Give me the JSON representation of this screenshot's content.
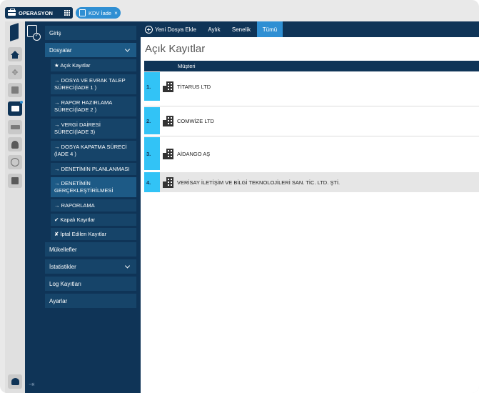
{
  "topbar": {
    "app_label": "OPERASYON",
    "doc_tab_label": "KDV İade",
    "doc_tab_close": "×"
  },
  "rail": {
    "icons": [
      "home-icon",
      "move-icon",
      "book-icon",
      "briefcase-icon",
      "money-icon",
      "user-icon",
      "globe-icon",
      "calculator-icon",
      "user-settings-icon"
    ]
  },
  "nav": {
    "giris": "Giriş",
    "dosyalar": "Dosyalar",
    "sub": {
      "acik": "★ Açık Kayıtlar",
      "dosya_evrak": "→ DOSYA VE EVRAK TALEP SÜRECİ(İADE 1 )",
      "rapor_hazirlama": "→ RAPOR HAZIRLAMA SÜRECİ(İADE 2 )",
      "vergi_dairesi": "→ VERGİ DAİRESİ SÜRECİ(İADE 3)",
      "dosya_kapatma": "→ DOSYA KAPATMA SÜRECİ (İADE 4 )",
      "denetim_plan": "→ DENETİMİN PLANLANMASI",
      "denetim_gerc": "→ DENETİMİN GERÇEKLEŞTİRİLMESİ",
      "raporlama": "→ RAPORLAMA",
      "kapali": "✔ Kapalı Kayıtlar",
      "iptal": "✘ İptal Edilen Kayıtlar"
    },
    "mukellefler": "Mükellefler",
    "istatistikler": "İstatistikler",
    "log": "Log Kayıtları",
    "ayarlar": "Ayarlar"
  },
  "toolbar": {
    "new_label": "Yeni Dosya Ekle",
    "tab_aylik": "Aylık",
    "tab_senelik": "Senelik",
    "tab_tumu": "Tümü",
    "active_tab": "Tümü"
  },
  "main": {
    "title": "Açık Kayıtlar",
    "column_header": "Müşteri",
    "rows": [
      {
        "num": "1.",
        "name": "TİTARUS LTD"
      },
      {
        "num": "2.",
        "name": "COMWİZE LTD"
      },
      {
        "num": "3.",
        "name": "AİDANGO AŞ"
      },
      {
        "num": "4.",
        "name": "VERİSAY İLETİŞİM VE BİLGİ TEKNOLOJİLERİ SAN. TİC. LTD. ŞTİ."
      }
    ]
  },
  "colors": {
    "navy": "#0f3457",
    "nav_item": "#164469",
    "accent_blue": "#2f8fd3",
    "row_number": "#32c3f6"
  }
}
